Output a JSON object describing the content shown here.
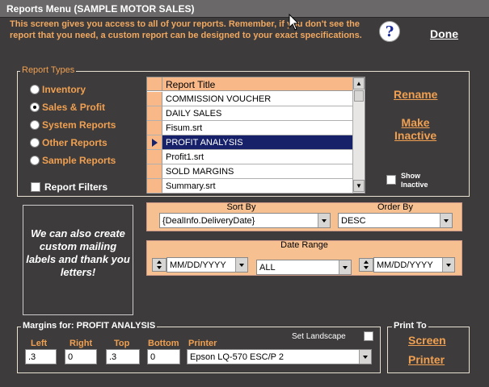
{
  "window": {
    "title": "Reports Menu  (SAMPLE MOTOR SALES)"
  },
  "intro_text": "This screen gives you access to all of your reports. Remember, if you don't see the report that you need, a custom report can be designed to your exact specifications.",
  "help_label": "?",
  "done_label": "Done",
  "report_types": {
    "legend": "Report Types",
    "options": [
      {
        "label": "Inventory",
        "selected": false
      },
      {
        "label": "Sales & Profit",
        "selected": true
      },
      {
        "label": "System Reports",
        "selected": false
      },
      {
        "label": "Other Reports",
        "selected": false
      },
      {
        "label": "Sample Reports",
        "selected": false
      }
    ],
    "filters_label": "Report Filters",
    "filters_checked": false
  },
  "reports_grid": {
    "header": "Report Title",
    "rows": [
      "COMMISSION VOUCHER",
      "DAILY SALES",
      "Fisum.srt",
      "PROFIT ANALYSIS",
      "Profit1.srt",
      "SOLD MARGINS",
      "Summary.srt"
    ],
    "selected_index": 3
  },
  "actions": {
    "rename": "Rename",
    "make_inactive_line1": "Make",
    "make_inactive_line2": "Inactive",
    "show_inactive_line1": "Show",
    "show_inactive_line2": "Inactive"
  },
  "promo_text": "We can also create custom mailing labels and thank you letters!",
  "sort": {
    "sort_by_label": "Sort By",
    "sort_by_value": "{DealInfo.DeliveryDate}",
    "order_by_label": "Order By",
    "order_by_value": "DESC"
  },
  "date_range": {
    "label": "Date Range",
    "from_placeholder": "MM/DD/YYYY",
    "range_value": "ALL",
    "to_placeholder": "MM/DD/YYYY"
  },
  "margins": {
    "legend": "Margins for: PROFIT ANALYSIS",
    "left_label": "Left",
    "left_value": ".3",
    "right_label": "Right",
    "right_value": "0",
    "top_label": "Top",
    "top_value": ".3",
    "bottom_label": "Bottom",
    "bottom_value": "0",
    "printer_label": "Printer",
    "printer_value": "Epson LQ-570 ESC/P 2",
    "landscape_label": "Set Landscape"
  },
  "print_to": {
    "legend": "Print To",
    "screen": "Screen",
    "printer": "Printer"
  }
}
